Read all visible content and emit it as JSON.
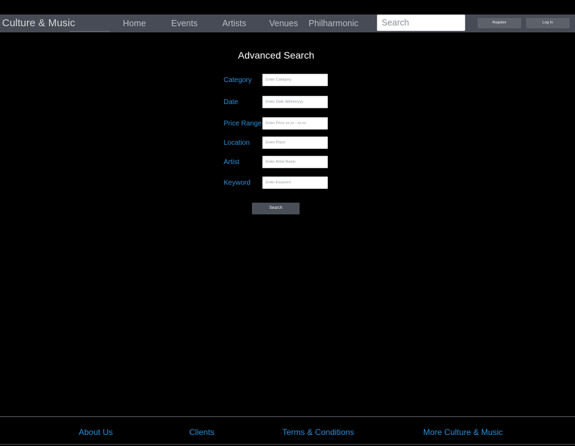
{
  "header": {
    "brand": "Culture & Music",
    "nav": {
      "home": "Home",
      "events": "Events",
      "artists": "Artists",
      "venues": "Venues",
      "philharmonic": "Philharmonic"
    },
    "search_placeholder": "Search",
    "register_label": "Register",
    "login_label": "Log In"
  },
  "main": {
    "title": "Advanced Search",
    "fields": {
      "category": {
        "label": "Category",
        "placeholder": "Enter Category"
      },
      "date": {
        "label": "Date",
        "placeholder": "Enter Date dd/mm/yyy"
      },
      "price_range": {
        "label": "Price Range",
        "placeholder": "Enter Price xx.xx - xx.xx"
      },
      "location": {
        "label": "Location",
        "placeholder": "Enter Place"
      },
      "artist": {
        "label": "Artist",
        "placeholder": "Enter Artist Name"
      },
      "keyword": {
        "label": "Keyword",
        "placeholder": "Enter Keyword"
      }
    },
    "submit_label": "Search"
  },
  "footer": {
    "about": "About Us",
    "clients": "Clients",
    "terms": "Terms & Conditions",
    "more": "More Culture & Music"
  },
  "colors": {
    "background": "#000000",
    "navbar": "#474b55",
    "accent": "#2b8fd8",
    "button": "#4a4e57"
  }
}
